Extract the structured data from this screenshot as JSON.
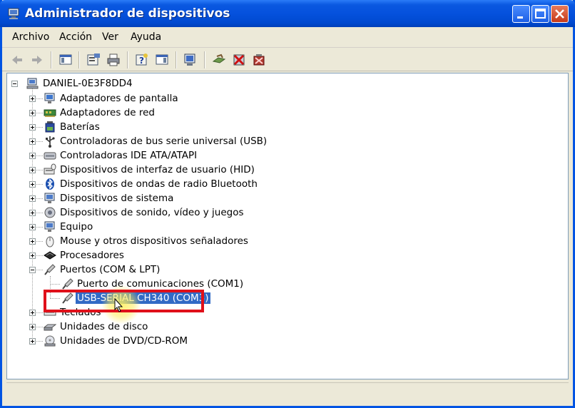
{
  "window": {
    "title": "Administrador de dispositivos",
    "accent": "#0054e3"
  },
  "menu": [
    "Archivo",
    "Acción",
    "Ver",
    "Ayuda"
  ],
  "toolbar_icons": [
    "back-icon",
    "forward-icon",
    "show-hide-console-tree-icon",
    "properties-icon",
    "print-icon",
    "help-icon",
    "show-hide-action-pane-icon",
    "scan-hardware-icon",
    "update-driver-icon",
    "disable-device-icon",
    "uninstall-device-icon"
  ],
  "tree": {
    "root": "DANIEL-0E3F8DD4",
    "categories": [
      {
        "label": "Adaptadores de pantalla",
        "icon": "display-adapter-icon"
      },
      {
        "label": "Adaptadores de red",
        "icon": "network-adapter-icon"
      },
      {
        "label": "Baterías",
        "icon": "battery-icon"
      },
      {
        "label": "Controladoras de bus serie universal (USB)",
        "icon": "usb-icon"
      },
      {
        "label": "Controladoras IDE ATA/ATAPI",
        "icon": "ide-controller-icon"
      },
      {
        "label": "Dispositivos de interfaz de usuario (HID)",
        "icon": "hid-icon"
      },
      {
        "label": "Dispositivos de ondas de radio Bluetooth",
        "icon": "bluetooth-icon"
      },
      {
        "label": "Dispositivos de sistema",
        "icon": "system-device-icon"
      },
      {
        "label": "Dispositivos de sonido, vídeo y juegos",
        "icon": "sound-icon"
      },
      {
        "label": "Equipo",
        "icon": "computer-icon"
      },
      {
        "label": "Mouse y otros dispositivos señaladores",
        "icon": "mouse-icon"
      },
      {
        "label": "Procesadores",
        "icon": "processor-icon"
      },
      {
        "label": "Puertos (COM & LPT)",
        "icon": "port-icon"
      },
      {
        "label": "Teclados",
        "icon": "keyboard-icon"
      },
      {
        "label": "Unidades de disco",
        "icon": "disk-drive-icon"
      },
      {
        "label": "Unidades de DVD/CD-ROM",
        "icon": "dvd-icon"
      }
    ],
    "ports_children": [
      {
        "label": "Puerto de comunicaciones (COM1)",
        "icon": "port-icon"
      },
      {
        "label": "USB-SERIAL CH340 (COM3)",
        "icon": "port-icon",
        "selected": true
      }
    ]
  },
  "colors": {
    "selection": "#316ac5",
    "highlight_box": "#e0101a"
  }
}
